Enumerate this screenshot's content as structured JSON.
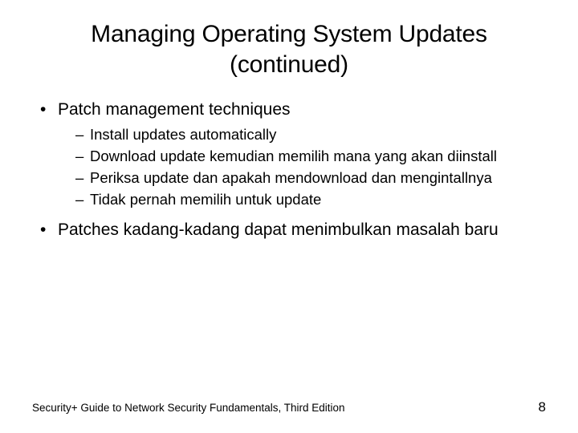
{
  "title_line1": "Managing Operating System Updates",
  "title_line2": "(continued)",
  "bullets": [
    {
      "text": "Patch management techniques",
      "subs": [
        "Install updates automatically",
        "Download update kemudian memilih mana yang akan diinstall",
        "Periksa update dan apakah mendownload dan mengintallnya",
        "Tidak pernah memilih untuk update"
      ]
    },
    {
      "text": "Patches kadang-kadang dapat menimbulkan masalah baru",
      "subs": []
    }
  ],
  "footer_text": "Security+ Guide to Network Security Fundamentals, Third Edition",
  "page_number": "8",
  "glyphs": {
    "bullet": "•",
    "dash": "–"
  }
}
